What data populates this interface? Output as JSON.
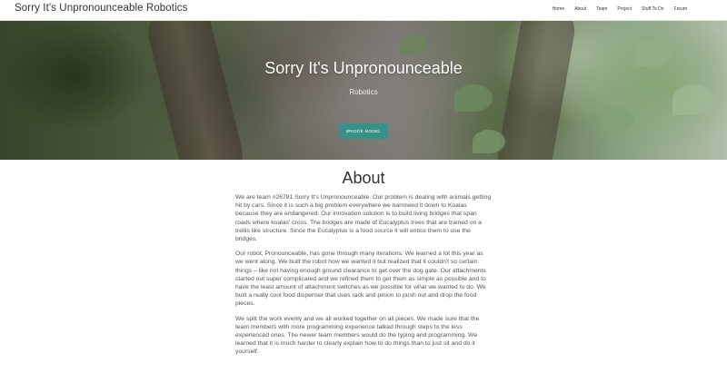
{
  "navbar": {
    "brand": "Sorry It's Unpronounceable Robotics",
    "items": [
      "Home",
      "About",
      "Team",
      "Project",
      "Stuff To Do",
      "Forum"
    ]
  },
  "hero": {
    "title": "Sorry It's Unpronounceable",
    "subtitle": "Robotics",
    "button_label": "BRIDGE MODEL",
    "image_icon": "koala-photo"
  },
  "about": {
    "heading": "About",
    "paragraphs": [
      "We are team #26781 Sorry It's Unpronounceable. Our problem is dealing with animals getting hit by cars. Since it is such a big problem everywhere we narrowed it down to Koalas because they are endangered. Our innovation solution is to build living bridges that span roads where koalas' cross. The bridges are made of Eucalyptus trees that are trained on a trellis like structure. Since the Eucalyptus is a food source it will entice them to use the bridges.",
      "Our robot, Pronounceable, has gone through many iterations. We learned a lot this year as we went along. We built the robot how we wanted it but realized that it couldn't so certain things – like not having enough ground clearance to get over the dog gate. Our attachments started out super complicated and we refined them to get them as simple as possible and to have the least amount of attachment switches as we possible for what we wanted to do. We built a really cool food dispenser that uses rack and pinion to push out and drop the food pieces.",
      "We split the work evenly and we all worked together on all pieces. We made sure that the team members with more programming experience talked through steps to the less experienced ones. The newer team members would do the typing and programming. We learned that it is much harder to clearly explain how to do things than to just sit and do it yourself."
    ]
  },
  "colors": {
    "button": "#3a8f88",
    "text": "#555555"
  }
}
